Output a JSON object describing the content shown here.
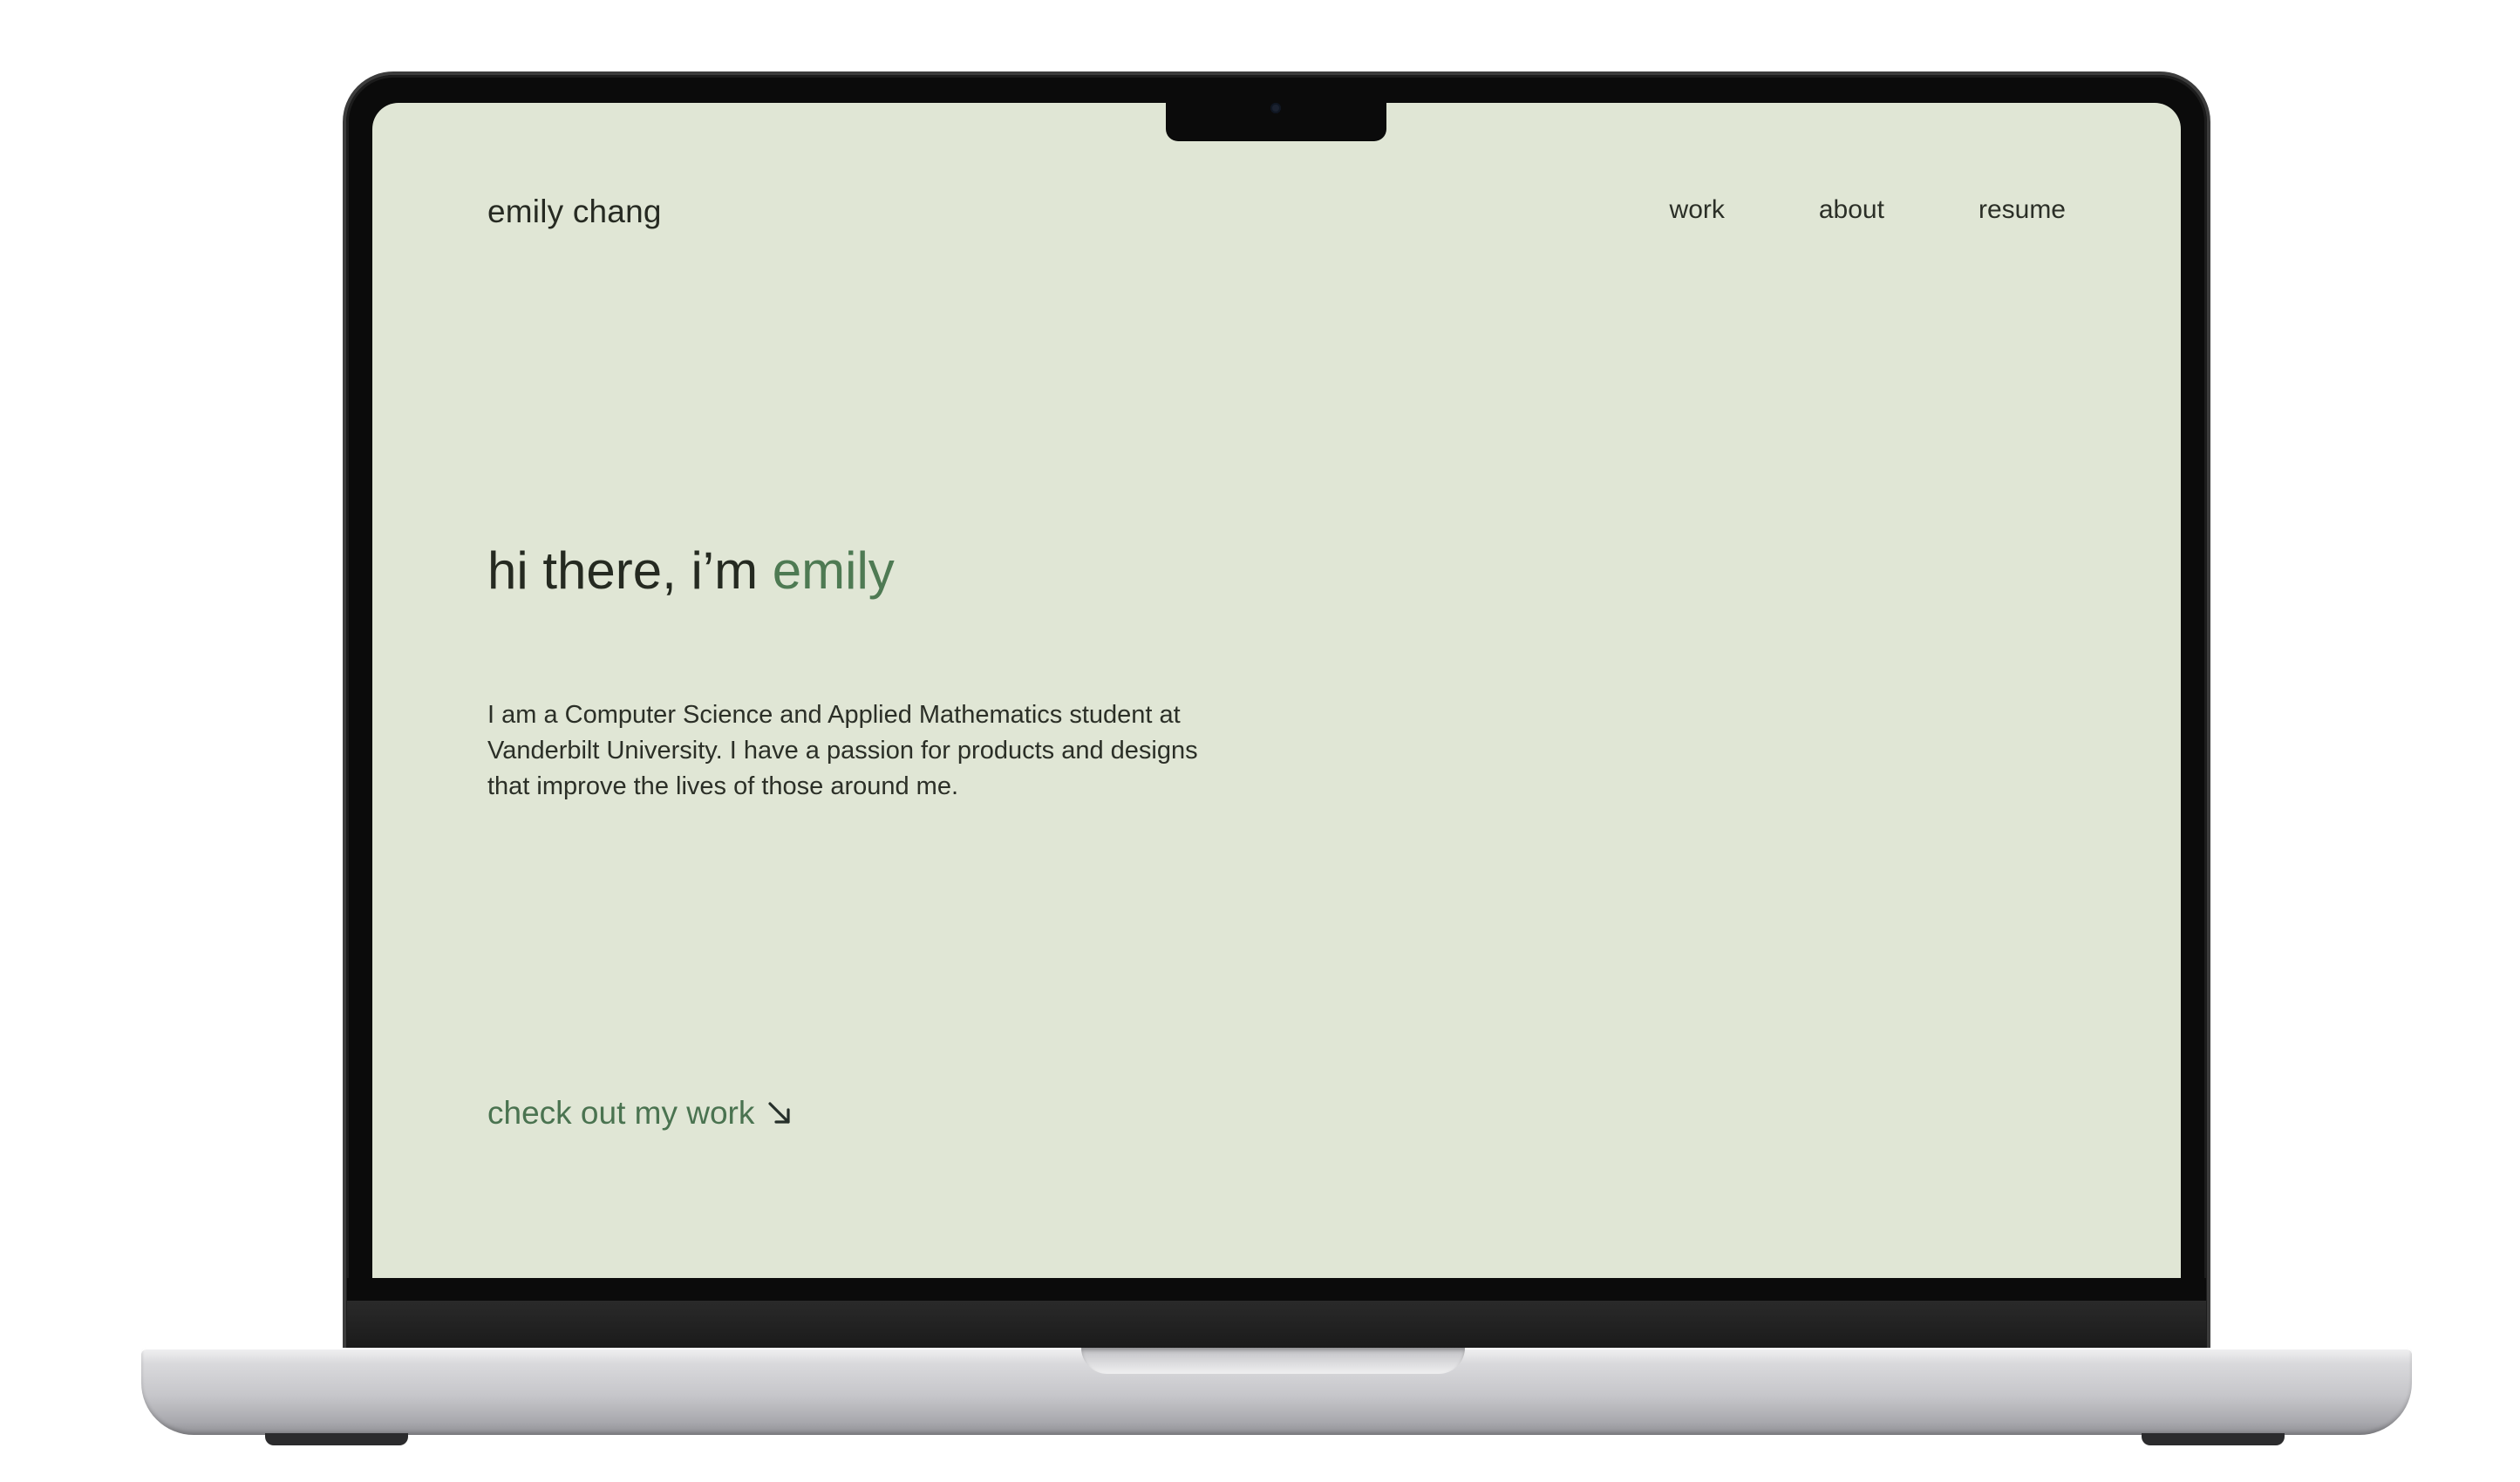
{
  "site": {
    "logo": "emily chang",
    "nav": [
      {
        "label": "work"
      },
      {
        "label": "about"
      },
      {
        "label": "resume"
      }
    ]
  },
  "hero": {
    "greeting": "hi there, i’m ",
    "name": "emily",
    "intro": "I am a Computer Science and Applied Mathematics student at Vanderbilt University. I have a passion for products and designs that improve the lives of those around me.",
    "cta_label": "check out my work",
    "cta_icon": "arrow-down-right-icon"
  },
  "colors": {
    "background": "#e0e6d5",
    "text": "#262a22",
    "accent": "#4e7a53"
  }
}
